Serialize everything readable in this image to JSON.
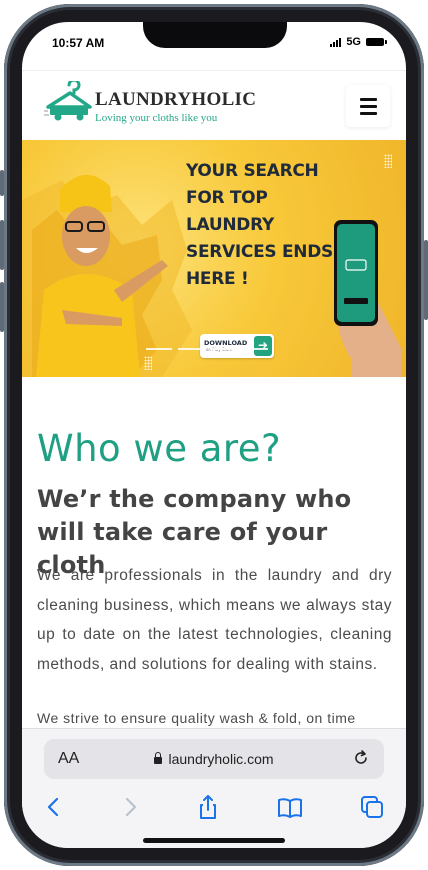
{
  "status_bar": {
    "time": "10:57 AM",
    "network": "5G"
  },
  "header": {
    "logo_text": "LAUNDRYHOLIC",
    "logo_tagline": "Loving your cloths like you"
  },
  "banner": {
    "headline": "YOUR SEARCH FOR TOP LAUNDRY SERVICES ENDS HERE !",
    "download_label": "DOWNLOAD",
    "download_sub": "on Play Store"
  },
  "about": {
    "title": "Who we are?",
    "subtitle": "We’r the company who will take care of your cloth",
    "paragraph1": "We are professionals in the laundry and dry cleaning business, which means we always stay up to date on the latest technologies, cleaning methods, and solutions for dealing with stains.",
    "paragraph2": "We strive to ensure quality wash & fold, on time"
  },
  "browser": {
    "text_size_label": "AA",
    "url": "laundryholic.com"
  },
  "colors": {
    "brand_teal": "#1fa083",
    "banner_yellow": "#f8c93a",
    "heading_grey": "#444444"
  }
}
